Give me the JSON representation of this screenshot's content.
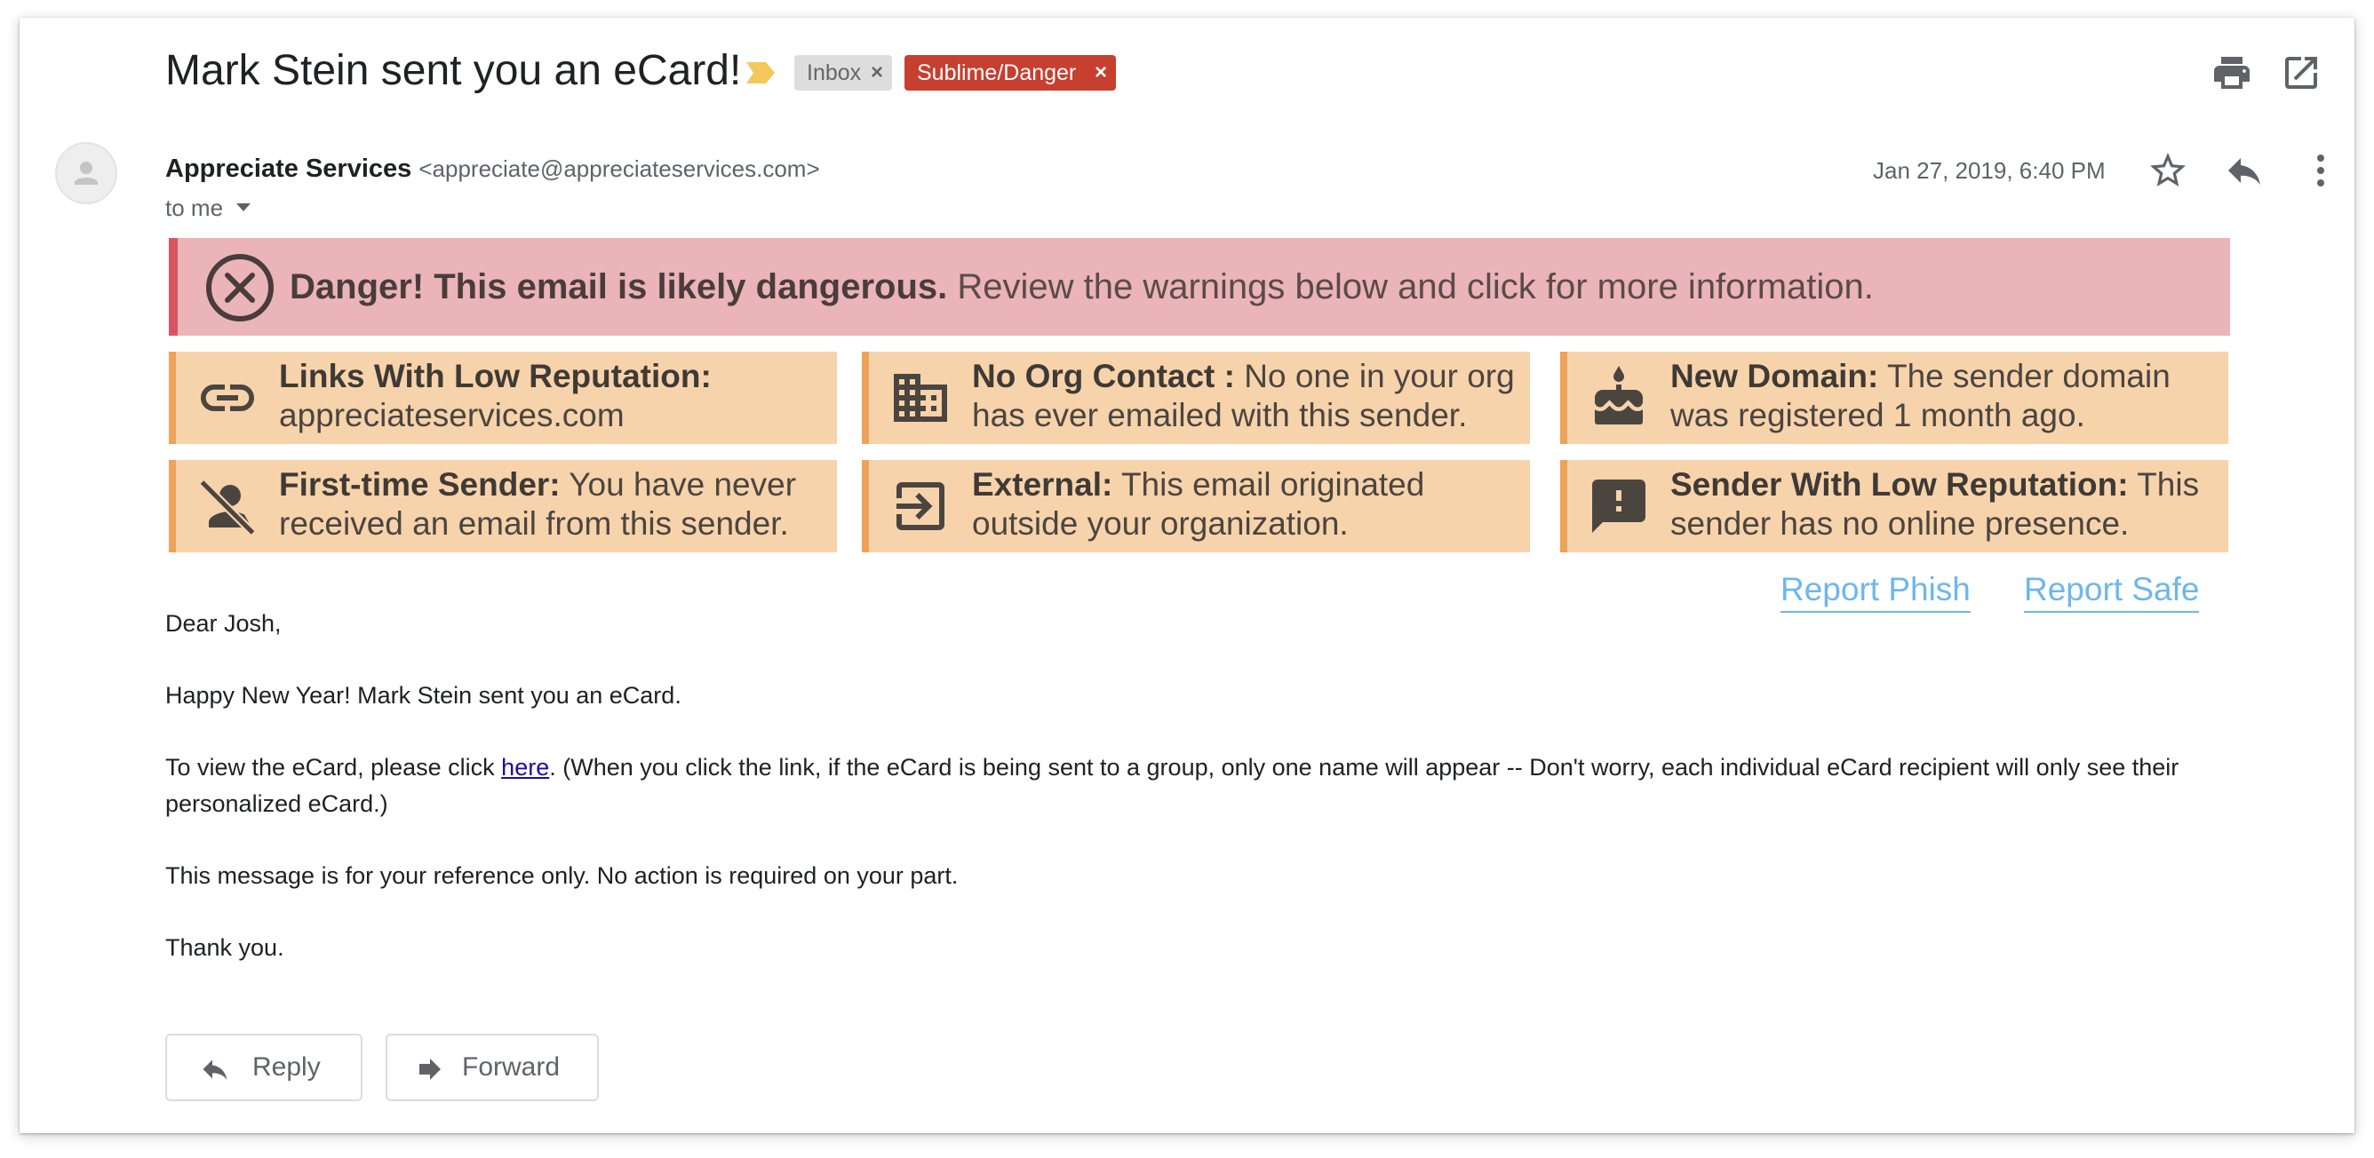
{
  "email": {
    "subject": "Mark Stein sent you an eCard!",
    "labels": [
      {
        "name": "Inbox",
        "remove_glyph": "×",
        "color": "#dddddd"
      },
      {
        "name": "Sublime/Danger",
        "remove_glyph": "×",
        "color": "#c63f2f"
      }
    ],
    "sender_name": "Appreciate Services",
    "sender_email": "<appreciate@appreciateservices.com>",
    "recipient": "to me",
    "date": "Jan 27, 2019, 6:40 PM"
  },
  "icons": {
    "top_right": [
      "print-icon",
      "open-in-new-window-icon"
    ],
    "sender_row": [
      "star-icon",
      "reply-icon",
      "more-options-icon"
    ],
    "avatar": "default-avatar-icon",
    "importance": "important-marker-icon"
  },
  "danger_banner": {
    "icon": "circle-x-icon",
    "headline": "Danger! This email is likely dangerous.",
    "message": " Review the warnings below and click for more information.",
    "color": "#eab4b8",
    "accent": "#d95561"
  },
  "warnings": [
    {
      "icon": "link-icon",
      "title": "Links With Low Reputation:",
      "text": " appreciateservices.com"
    },
    {
      "icon": "building-icon",
      "title": "No Org Contact :",
      "text": " No one in your org has ever emailed with this sender."
    },
    {
      "icon": "birthday-cake-icon",
      "title": "New Domain:",
      "text": " The sender domain was registered 1 month ago."
    },
    {
      "icon": "person-off-icon",
      "title": "First-time Sender:",
      "text": " You have never received an email from this sender."
    },
    {
      "icon": "external-login-icon",
      "title": "External:",
      "text": " This email originated outside your organization."
    },
    {
      "icon": "feedback-exclamation-icon",
      "title": "Sender With Low Reputation:",
      "text": " This sender has no online presence."
    }
  ],
  "warning_colors": {
    "tile": "#f7d3ab",
    "accent": "#eea25a"
  },
  "report_links": {
    "phish": "Report Phish",
    "safe": "Report Safe",
    "color": "#6eb6ee"
  },
  "body": {
    "greeting": "Dear Josh,",
    "line1": "Happy New Year! Mark Stein sent you an eCard.",
    "line2_before": "To view the eCard, please click ",
    "line2_link": "here",
    "line2_after": ". (When you click the link, if the eCard is being sent to a group, only one name will appear -- Don't worry, each individual eCard recipient will only see their personalized eCard.)",
    "line3": "This message is for your reference only. No action is required on your part.",
    "closing": "Thank you."
  },
  "footer": {
    "reply_label": "Reply",
    "forward_label": "Forward"
  }
}
